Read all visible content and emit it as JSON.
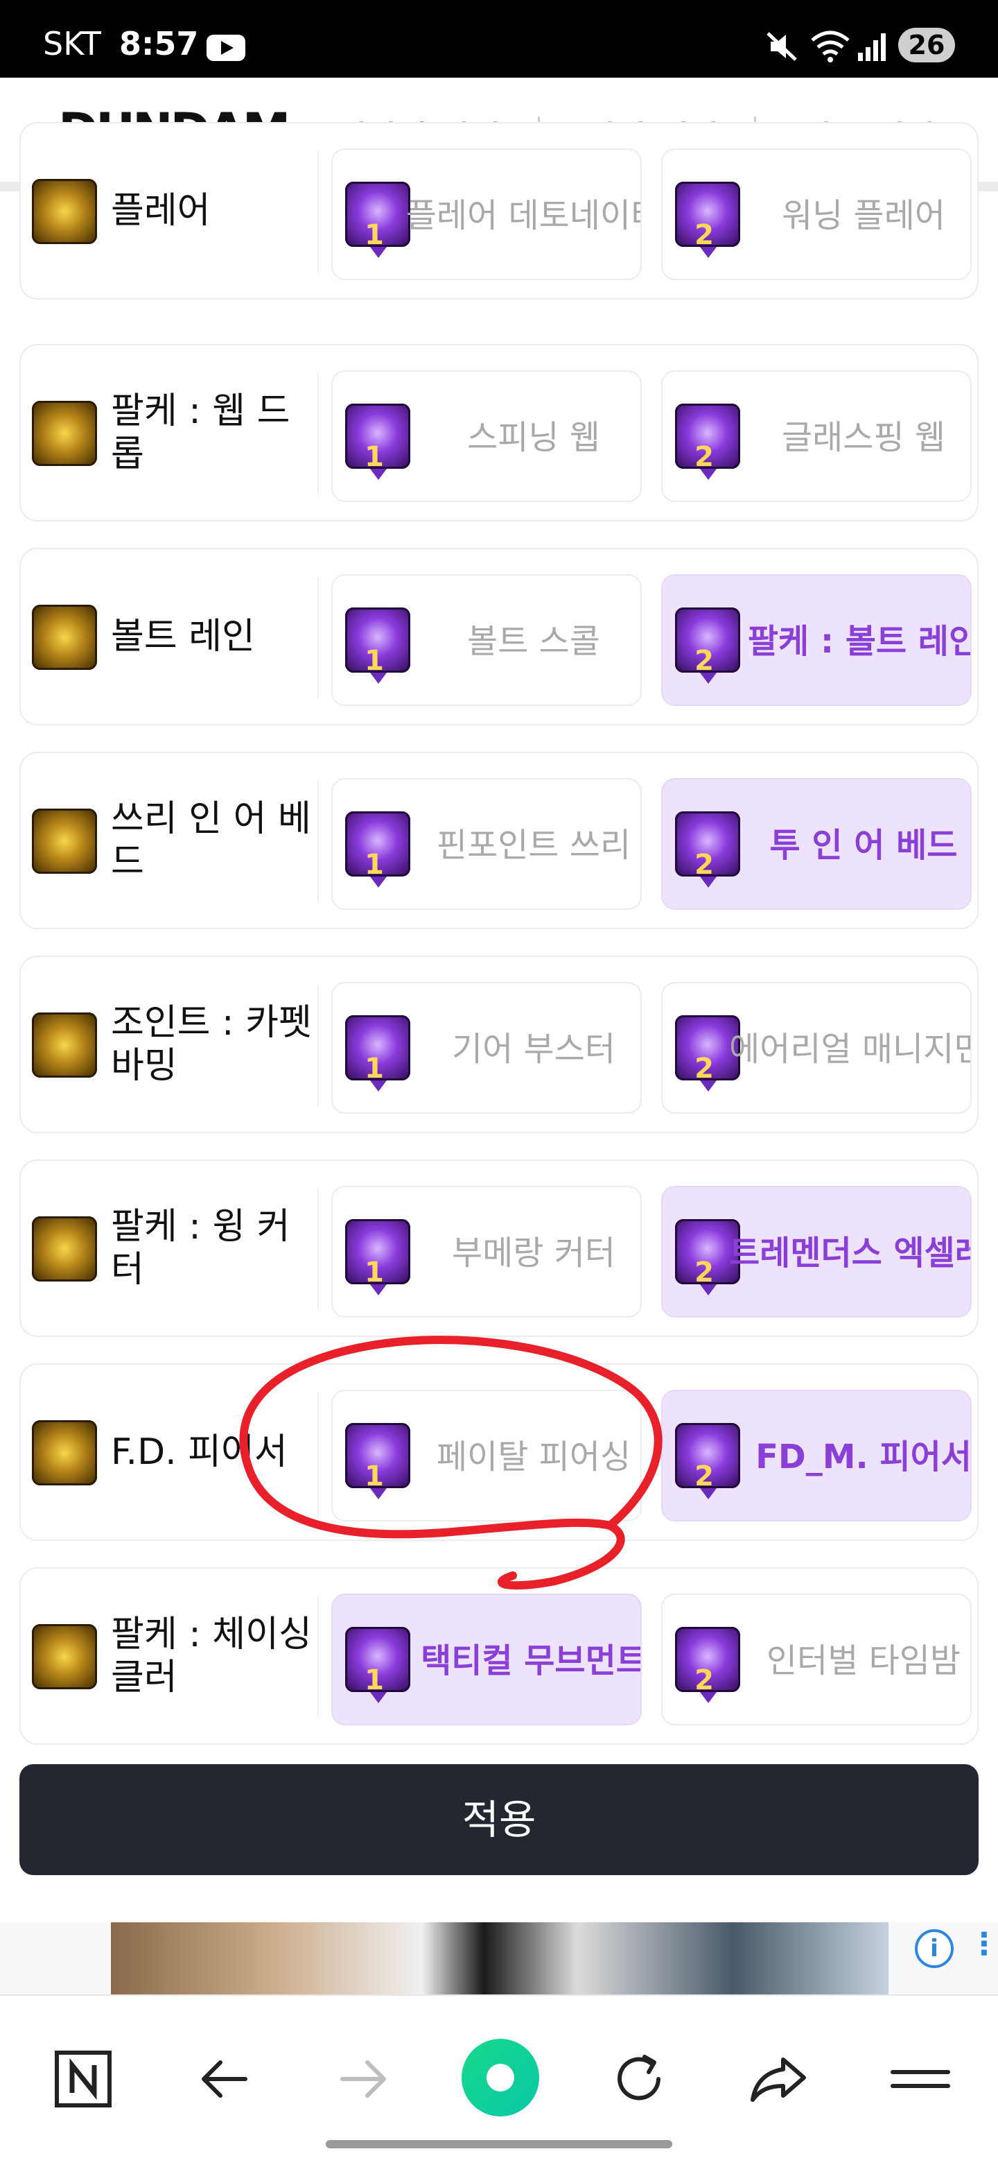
{
  "status_bar": {
    "carrier": "SKT",
    "time": "8:57",
    "battery": "26"
  },
  "header": {
    "logo": "DUNDAM",
    "nav": [
      "캐릭터 검색",
      "딜러 랭킹",
      "버프 랭킹"
    ]
  },
  "skills": [
    {
      "name": "플레어",
      "options": [
        {
          "num": "1",
          "label": "플레어 데토네이터",
          "selected": false
        },
        {
          "num": "2",
          "label": "워닝 플레어",
          "selected": false
        }
      ]
    },
    {
      "name": "팔케 : 웹 드롭",
      "options": [
        {
          "num": "1",
          "label": "스피닝 웹",
          "selected": false
        },
        {
          "num": "2",
          "label": "글래스핑 웹",
          "selected": false
        }
      ]
    },
    {
      "name": "볼트 레인",
      "options": [
        {
          "num": "1",
          "label": "볼트 스콜",
          "selected": false
        },
        {
          "num": "2",
          "label": "팔케 : 볼트 레인",
          "selected": true
        }
      ]
    },
    {
      "name": "쓰리 인 어 베드",
      "options": [
        {
          "num": "1",
          "label": "핀포인트 쓰리",
          "selected": false
        },
        {
          "num": "2",
          "label": "투 인 어 베드",
          "selected": true
        }
      ]
    },
    {
      "name": "조인트 : 카펫 바밍",
      "options": [
        {
          "num": "1",
          "label": "기어 부스터",
          "selected": false
        },
        {
          "num": "2",
          "label": "에어리얼 매니지먼트",
          "selected": false
        }
      ]
    },
    {
      "name": "팔케 : 윙 커터",
      "options": [
        {
          "num": "1",
          "label": "부메랑 커터",
          "selected": false
        },
        {
          "num": "2",
          "label": "트레멘더스 엑셀레이션",
          "selected": true
        }
      ]
    },
    {
      "name": "F.D. 피어서",
      "options": [
        {
          "num": "1",
          "label": "페이탈 피어싱",
          "selected": false
        },
        {
          "num": "2",
          "label": "FD_M. 피어서",
          "selected": true
        }
      ]
    },
    {
      "name": "팔케 : 체이싱 클러",
      "options": [
        {
          "num": "1",
          "label": "택티컬 무브먼트",
          "selected": true
        },
        {
          "num": "2",
          "label": "인터벌 타임밤",
          "selected": false
        }
      ]
    }
  ],
  "apply_label": "적용",
  "ad": {
    "info_label": "i"
  },
  "bottom_bar": [
    "n-icon",
    "back-arrow-icon",
    "forward-arrow-icon",
    "home-circle-icon",
    "refresh-icon",
    "share-icon",
    "menu-icon"
  ],
  "colors": {
    "selected_bg": "#eee3fc",
    "selected_text": "#8a3fd6",
    "apply_bg": "#23272f",
    "annotation": "#e8202a",
    "home_circle": "#19d98a"
  }
}
